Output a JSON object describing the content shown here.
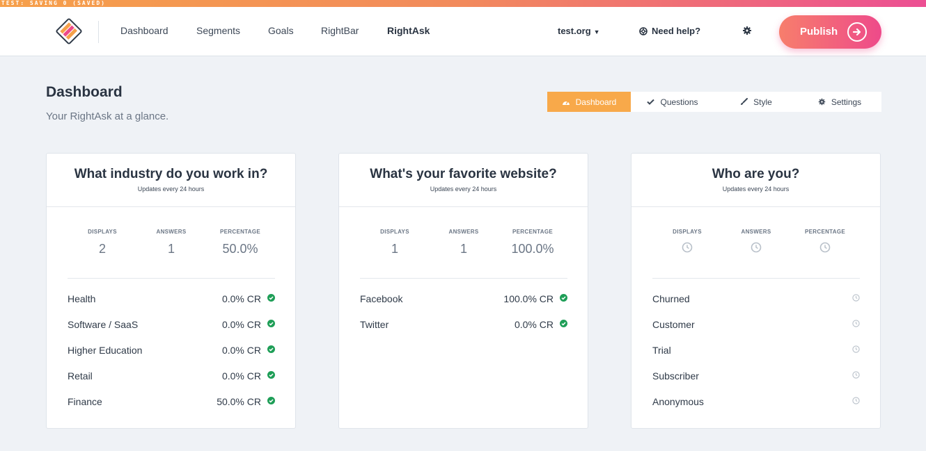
{
  "status_bar": {
    "text": "TEST: SAVING 0 (SAVED)"
  },
  "colors": {
    "accent": "#f8a94a",
    "publish_start": "#f77e6c",
    "publish_end": "#ee4a8a",
    "success": "#1e9e57",
    "pending": "#b8c0c9"
  },
  "nav": {
    "items": [
      {
        "label": "Dashboard"
      },
      {
        "label": "Segments"
      },
      {
        "label": "Goals"
      },
      {
        "label": "RightBar"
      },
      {
        "label": "RightAsk",
        "active": true
      }
    ],
    "org": "test.org",
    "help": "Need help?",
    "publish": "Publish"
  },
  "page": {
    "title": "Dashboard",
    "subtitle": "Your RightAsk at a glance."
  },
  "tabs": [
    {
      "label": "Dashboard",
      "icon": "gauge-icon",
      "active": true
    },
    {
      "label": "Questions",
      "icon": "check-icon"
    },
    {
      "label": "Style",
      "icon": "brush-icon"
    },
    {
      "label": "Settings",
      "icon": "gear-icon"
    }
  ],
  "stat_labels": {
    "displays": "DISPLAYS",
    "answers": "ANSWERS",
    "percentage": "PERCENTAGE"
  },
  "cards": [
    {
      "title": "What industry do you work in?",
      "subtitle": "Updates every 24 hours",
      "displays": "2",
      "answers": "1",
      "percentage": "50.0%",
      "rows": [
        {
          "label": "Health",
          "value": "0.0% CR"
        },
        {
          "label": "Software / SaaS",
          "value": "0.0% CR"
        },
        {
          "label": "Higher Education",
          "value": "0.0% CR"
        },
        {
          "label": "Retail",
          "value": "0.0% CR"
        },
        {
          "label": "Finance",
          "value": "50.0% CR"
        }
      ]
    },
    {
      "title": "What's your favorite website?",
      "subtitle": "Updates every 24 hours",
      "displays": "1",
      "answers": "1",
      "percentage": "100.0%",
      "rows": [
        {
          "label": "Facebook",
          "value": "100.0% CR"
        },
        {
          "label": "Twitter",
          "value": "0.0% CR"
        }
      ]
    },
    {
      "title": "Who are you?",
      "subtitle": "Updates every 24 hours",
      "pending": true,
      "rows": [
        {
          "label": "Churned"
        },
        {
          "label": "Customer"
        },
        {
          "label": "Trial"
        },
        {
          "label": "Subscriber"
        },
        {
          "label": "Anonymous"
        }
      ]
    }
  ]
}
